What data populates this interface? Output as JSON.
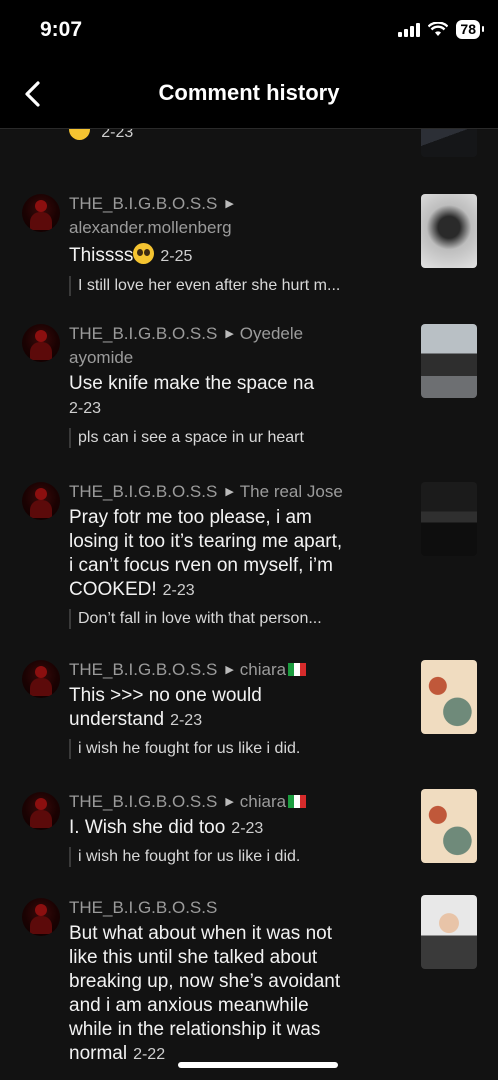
{
  "status_bar": {
    "time": "9:07",
    "battery": "78"
  },
  "header": {
    "title": "Comment history"
  },
  "items": [
    {
      "date": "2-23"
    },
    {
      "user": "THE_B.I.G.B.O.S.S",
      "target": "alexander.mollenberg",
      "comment": "Thissss",
      "date": "2-25",
      "reply": "I still love her even after she hurt m..."
    },
    {
      "user": "THE_B.I.G.B.O.S.S",
      "target_first": "Oyedele",
      "target_second": "ayomide",
      "comment": "Use knife make the space na",
      "date": "2-23",
      "reply": "pls can i see a space in ur heart"
    },
    {
      "user": "THE_B.I.G.B.O.S.S",
      "target": "The real Jose",
      "comment_lines": [
        "Pray fotr me too please, i am",
        "losing it too it’s tearing me apart,",
        "i can’t focus rven on myself, i’m",
        "COOKED!"
      ],
      "date": "2-23",
      "reply": "Don’t fall in love with that person..."
    },
    {
      "user": "THE_B.I.G.B.O.S.S",
      "target": "chiara",
      "comment_lines": [
        "This >>> no one would",
        "understand"
      ],
      "date": "2-23",
      "reply": "i wish he fought for us like i did."
    },
    {
      "user": "THE_B.I.G.B.O.S.S",
      "target": "chiara",
      "comment": "I. Wish she did too",
      "date": "2-23",
      "reply": "i wish he fought for us like i did."
    },
    {
      "user": "THE_B.I.G.B.O.S.S",
      "comment_lines": [
        "But what about when it was not",
        "like this until she talked about",
        "breaking up, now she’s avoidant",
        "and i am anxious meanwhile",
        "while in the relationship it was",
        "normal"
      ],
      "date": "2-22"
    }
  ]
}
